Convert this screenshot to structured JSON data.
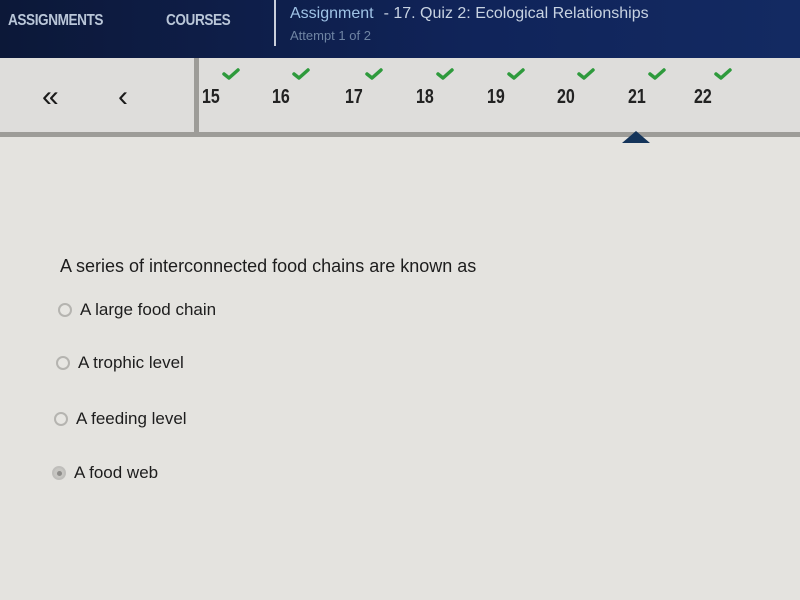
{
  "topbar": {
    "nav_assignments": "ASSIGNMENTS",
    "nav_courses": "COURSES",
    "title_prefix": "Assignment",
    "title_name": "- 17. Quiz 2: Ecological Relationships",
    "attempt": "Attempt 1 of 2"
  },
  "question_nav": {
    "first_icon": "double-chevron-left-icon",
    "first_glyph": "«",
    "prev_icon": "chevron-left-icon",
    "prev_glyph": "‹",
    "current": "21",
    "check_color": "#2e9a3c",
    "questions": [
      {
        "number": "15",
        "answered": true
      },
      {
        "number": "16",
        "answered": true
      },
      {
        "number": "17",
        "answered": true
      },
      {
        "number": "18",
        "answered": true
      },
      {
        "number": "19",
        "answered": true
      },
      {
        "number": "20",
        "answered": true
      },
      {
        "number": "21",
        "answered": true
      },
      {
        "number": "22",
        "answered": true
      }
    ]
  },
  "question": {
    "text": "A series of interconnected food chains are known as",
    "options": [
      {
        "label": "A large food chain",
        "selected": false
      },
      {
        "label": "A trophic level",
        "selected": false
      },
      {
        "label": "A feeding level",
        "selected": false
      },
      {
        "label": "A food web",
        "selected": true
      }
    ]
  }
}
